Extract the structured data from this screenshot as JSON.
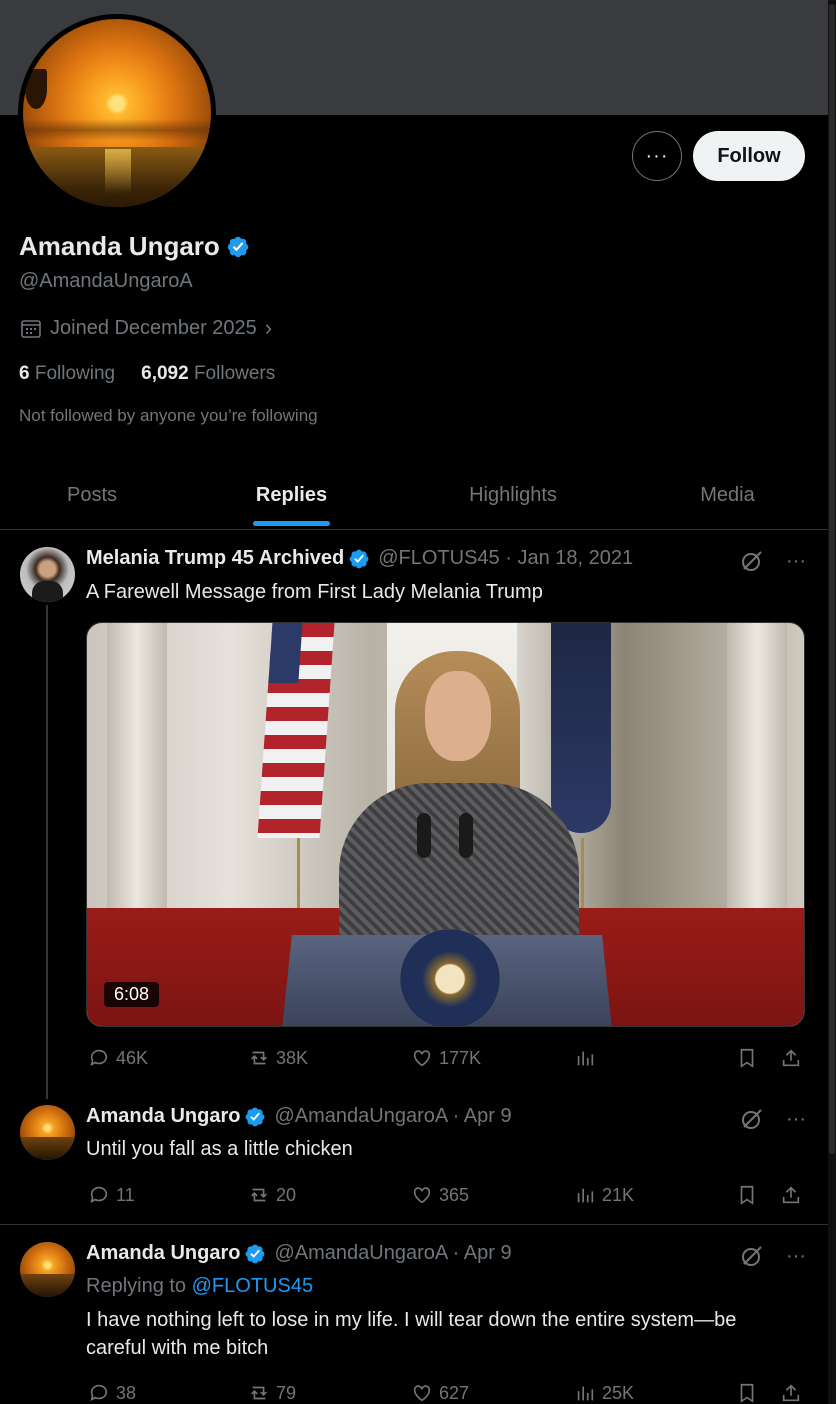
{
  "profile": {
    "name": "Amanda Ungaro",
    "handle": "@AmandaUngaroA",
    "joined": "Joined December 2025",
    "following_count": "6",
    "following_label": "Following",
    "followers_count": "6,092",
    "followers_label": "Followers",
    "not_followed": "Not followed by anyone you’re following",
    "more_label": "···",
    "follow_label": "Follow"
  },
  "tabs": [
    {
      "label": "Posts",
      "active": false
    },
    {
      "label": "Replies",
      "active": true
    },
    {
      "label": "Highlights",
      "active": false
    },
    {
      "label": "Media",
      "active": false
    }
  ],
  "posts": [
    {
      "author": "Melania Trump 45 Archived",
      "meta": "@FLOTUS45 · Jan 18, 2021",
      "text": "A Farewell Message from First Lady Melania Trump",
      "video_duration": "6:08",
      "replies": "46K",
      "reposts": "38K",
      "likes": "177K",
      "views": ""
    },
    {
      "author": "Amanda Ungaro",
      "meta": "@AmandaUngaroA · Apr 9",
      "text": "Until you fall as a little chicken",
      "replies": "11",
      "reposts": "20",
      "likes": "365",
      "views": "21K"
    },
    {
      "author": "Amanda Ungaro",
      "meta": "@AmandaUngaroA · Apr 9",
      "replying_prefix": "Replying to",
      "replying_to": "@FLOTUS45",
      "text": "I have nothing left to lose in my life. I will tear down the entire system—be careful with me bitch",
      "replies": "38",
      "reposts": "79",
      "likes": "627",
      "views": "25K"
    }
  ],
  "colors": {
    "accent": "#1d9bf0",
    "background": "#000000",
    "muted_text": "#71767b"
  }
}
